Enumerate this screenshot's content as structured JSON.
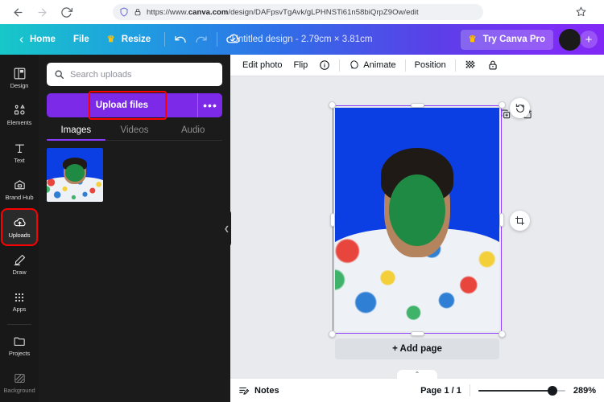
{
  "browser": {
    "back_icon": "arrow-left-icon",
    "forward_icon": "arrow-right-icon",
    "reload_icon": "reload-icon",
    "shield_icon": "shield-icon",
    "lock_icon": "lock-icon",
    "url_prefix": "https://www.",
    "url_domain": "canva.com",
    "url_suffix": "/design/DAFpsvTgAvk/gLPHNSTi61n58biQrpZ9Ow/edit",
    "bookmark_icon": "star-icon"
  },
  "header": {
    "home_label": "Home",
    "file_label": "File",
    "resize_label": "Resize",
    "undo_icon": "undo-icon",
    "redo_icon": "redo-icon",
    "cloud_icon": "cloud-saved-icon",
    "title": "Untitled design - 2.79cm × 3.81cm",
    "pro_label": "Try Canva Pro",
    "plus_label": "+",
    "gradient_start": "#17c8c8",
    "gradient_end": "#8127f5"
  },
  "rail": {
    "items": [
      {
        "label": "Design",
        "icon": "design-icon",
        "active": false
      },
      {
        "label": "Elements",
        "icon": "elements-icon",
        "active": false
      },
      {
        "label": "Text",
        "icon": "text-icon",
        "active": false
      },
      {
        "label": "Brand Hub",
        "icon": "brand-hub-icon",
        "active": false
      },
      {
        "label": "Uploads",
        "icon": "uploads-icon",
        "active": true
      },
      {
        "label": "Draw",
        "icon": "draw-icon",
        "active": false
      },
      {
        "label": "Apps",
        "icon": "apps-icon",
        "active": false
      },
      {
        "label": "Projects",
        "icon": "projects-icon",
        "active": false
      },
      {
        "label": "Background",
        "icon": "background-icon",
        "active": false
      }
    ],
    "highlight_color": "#ff0000"
  },
  "panel": {
    "search_placeholder": "Search uploads",
    "search_icon": "search-icon",
    "upload_button_label": "Upload files",
    "upload_more_icon": "ellipsis-icon",
    "upload_button_color": "#7d2ae8",
    "highlight_color": "#ff0000",
    "tabs": [
      {
        "label": "Images",
        "active": true
      },
      {
        "label": "Videos",
        "active": false
      },
      {
        "label": "Audio",
        "active": false
      }
    ],
    "collapse_icon": "chevron-left-icon"
  },
  "toolbar": {
    "edit_photo_label": "Edit photo",
    "flip_label": "Flip",
    "info_icon": "info-icon",
    "animate_label": "Animate",
    "animate_icon": "animate-icon",
    "position_label": "Position",
    "transparency_icon": "transparency-icon",
    "lock_icon": "lock-icon"
  },
  "canvas": {
    "float_icons": [
      "lock-icon",
      "duplicate-icon",
      "add-page-icon"
    ],
    "rotate_icon": "rotate-icon",
    "crop_icon": "crop-icon",
    "add_page_label": "+ Add page",
    "selection_color": "#8b3dff",
    "artwork_background": "#0b3fe4",
    "face_mask_color": "#1f8a43"
  },
  "bottom": {
    "notes_label": "Notes",
    "notes_icon": "notes-icon",
    "page_indicator": "Page 1 / 1",
    "zoom_level": "289%",
    "collapse_icon": "chevron-up-icon"
  }
}
